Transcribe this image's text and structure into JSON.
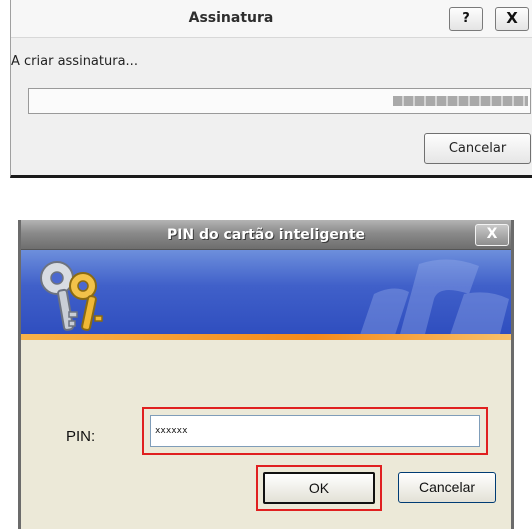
{
  "signing_dialog": {
    "title": "Assinatura",
    "help_label": "?",
    "close_label": "X",
    "status_text": "A criar assinatura...",
    "progress": 0.27,
    "cancel_label": "Cancelar"
  },
  "pin_dialog": {
    "title": "PIN do cartão inteligente",
    "close_label": "X",
    "banner_icon": "keys-icon",
    "pin_label": "PIN:",
    "pin_value": "xxxxxx",
    "ok_label": "OK",
    "cancel_label": "Cancelar"
  },
  "colors": {
    "highlight": "#e02020",
    "banner_blue": "#4060c9",
    "banner_orange": "#f48a1b"
  }
}
